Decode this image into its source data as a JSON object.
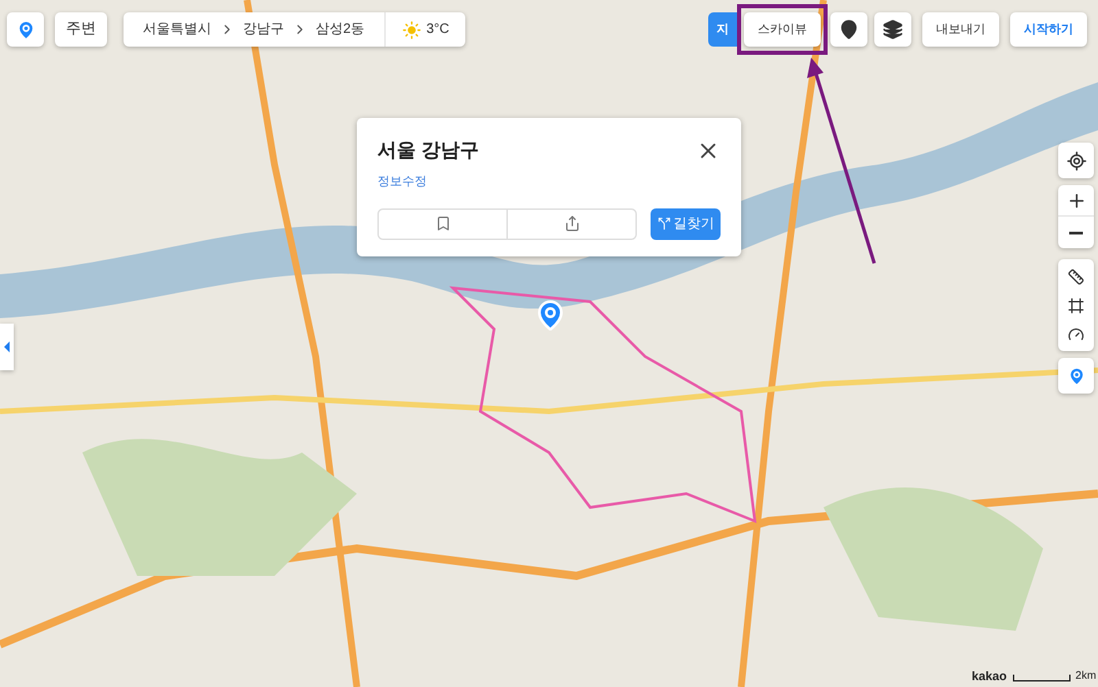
{
  "top_bar": {
    "nearby_button": "주변",
    "breadcrumb": [
      {
        "label": "서울특별시"
      },
      {
        "label": "강남구"
      },
      {
        "label": "삼성2동"
      }
    ],
    "weather": {
      "temperature": "3°C"
    }
  },
  "map_types": [
    {
      "label": "지",
      "selected": true
    },
    {
      "label": "스카이뷰",
      "selected": false
    }
  ],
  "actions": [
    {
      "label": "내보내기",
      "kind": "plain"
    },
    {
      "label": "시작하기",
      "kind": "primary"
    }
  ],
  "popup": {
    "title": "서울 강남구",
    "edit_link": "정보수정",
    "route_button": "길찾기"
  },
  "footer": {
    "logo": "kakao",
    "scale": "2km"
  }
}
